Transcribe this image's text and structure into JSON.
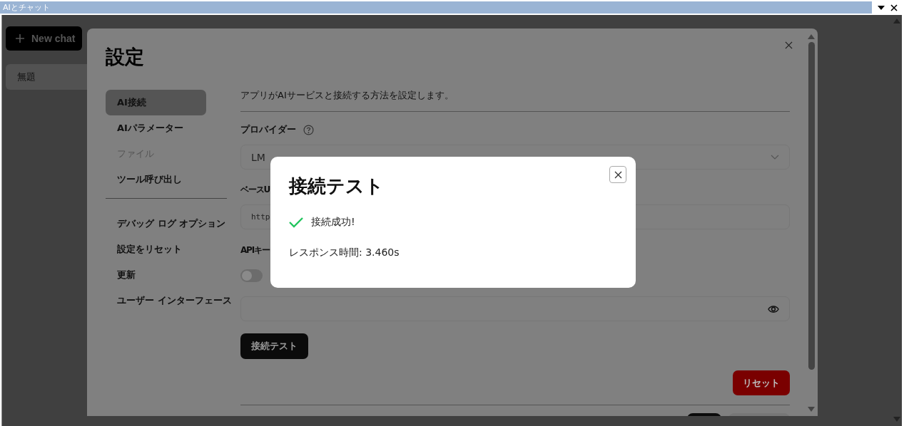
{
  "window": {
    "title": "AIとチャット"
  },
  "sidebar": {
    "new_chat": "New chat",
    "chats": [
      {
        "label": "無題",
        "selected": true
      }
    ]
  },
  "settings": {
    "title": "設定",
    "nav_groups": [
      [
        {
          "label": "AI接続",
          "selected": true,
          "disabled": false
        },
        {
          "label": "AIパラメーター",
          "selected": false,
          "disabled": false
        },
        {
          "label": "ファイル",
          "selected": false,
          "disabled": true
        },
        {
          "label": "ツール呼び出し",
          "selected": false,
          "disabled": false
        }
      ],
      [
        {
          "label": "デバッグ ログ オプション",
          "selected": false,
          "disabled": false
        },
        {
          "label": "設定をリセット",
          "selected": false,
          "disabled": false
        },
        {
          "label": "更新",
          "selected": false,
          "disabled": false
        },
        {
          "label": "ユーザー インターフェース",
          "selected": false,
          "disabled": false
        }
      ]
    ],
    "description": "アプリがAIサービスと接続する方法を設定します。",
    "provider": {
      "label": "プロバイダー",
      "value": "LM"
    },
    "base_url": {
      "label": "ベースU",
      "value": "http"
    },
    "api_key": {
      "label": "APIキー",
      "toggle_on": false
    },
    "test_button": "接続テスト",
    "reset_button": "リセット"
  },
  "dialog": {
    "title": "接続テスト",
    "status": "接続成功!",
    "success": true,
    "response_time": "レスポンス時間: 3.460s"
  }
}
